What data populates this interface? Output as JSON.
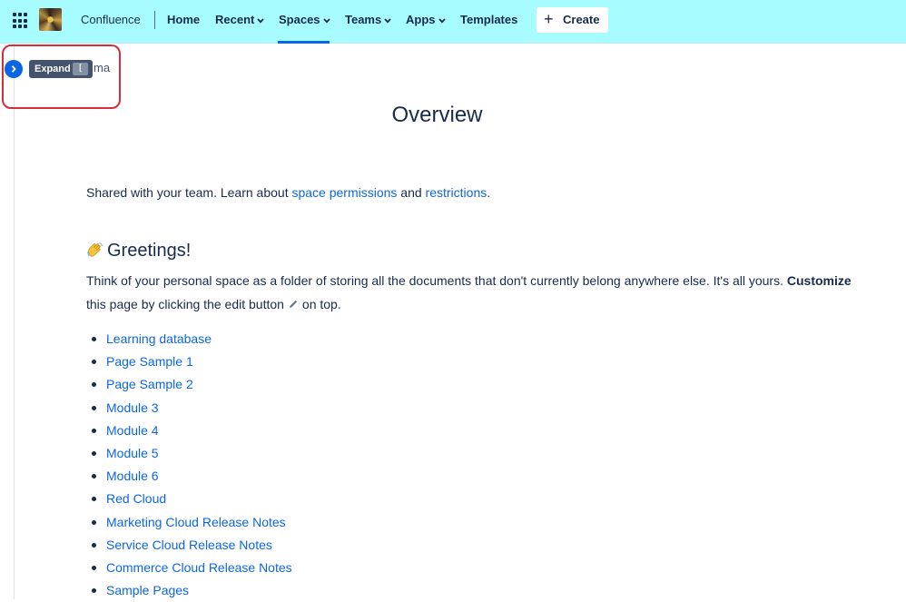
{
  "topnav": {
    "product": "Confluence",
    "items": [
      {
        "label": "Home"
      },
      {
        "label": "Recent"
      },
      {
        "label": "Spaces"
      },
      {
        "label": "Teams"
      },
      {
        "label": "Apps"
      },
      {
        "label": "Templates"
      }
    ],
    "active_item": "Spaces",
    "create_label": "Create",
    "background_color": "#a6fcff"
  },
  "sidebar": {
    "expand_tooltip": "Expand",
    "expand_shortcut": "[",
    "breadcrumb_fragment": "ma"
  },
  "page": {
    "title": "Overview",
    "intro": {
      "text_before": "Shared with your team. Learn about ",
      "link1": "space permissions",
      "text_middle": " and ",
      "link2": "restrictions",
      "text_after": "."
    },
    "greeting_emoji": "waving-hand-icon",
    "greeting_heading": "Greetings!",
    "body": {
      "text1": "Think of your personal space as a folder of storing all the documents that don't currently belong anywhere else. It's all yours. ",
      "bold": "Customize",
      "text2": "this page by clicking the edit button",
      "text3": "on top."
    },
    "links": [
      "Learning database",
      "Page Sample 1",
      "Page Sample 2",
      "Module 3",
      "Module 4",
      "Module 5",
      "Module 6",
      "Red Cloud",
      "Marketing Cloud Release Notes",
      "Service Cloud Release Notes",
      "Commerce Cloud Release Notes",
      "Sample Pages"
    ]
  },
  "colors": {
    "link": "#0c66e4",
    "text": "#172b4d",
    "highlight_border": "#d32f3a"
  }
}
